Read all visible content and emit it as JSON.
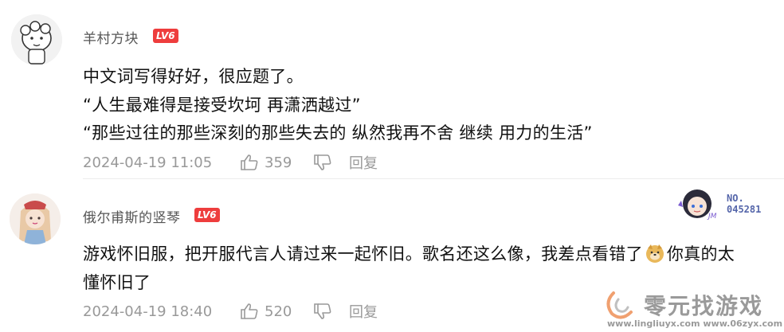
{
  "comments": [
    {
      "username": "羊村方块",
      "level": "LV6",
      "lines": [
        "中文词写得好好，很应题了。",
        "“人生最难得是接受坎坷 再潇洒越过”",
        "“那些过往的那些深刻的那些失去的 纵然我再不舍 继续 用力的生活”"
      ],
      "date": "2024-04-19 11:05",
      "likes": "359",
      "reply_label": "回复"
    },
    {
      "username": "俄尔甫斯的竖琴",
      "level": "LV6",
      "lines": [
        "游戏怀旧服，把开服代言人请过来一起怀旧。歌名还这么像，我差点看错了",
        "你真的太",
        "懂怀旧了"
      ],
      "date": "2024-04-19 18:40",
      "likes": "520",
      "reply_label": "回复"
    }
  ],
  "hero_badge": {
    "label": "NO.",
    "number": "045281"
  },
  "watermark": {
    "title": "零元找游戏",
    "urls": "www.lingliuyx.com    www.06zyx.com"
  },
  "colors": {
    "level_badge": "#ee3d3d",
    "meta_text": "#999999",
    "body_text": "#111111",
    "username": "#555555"
  }
}
